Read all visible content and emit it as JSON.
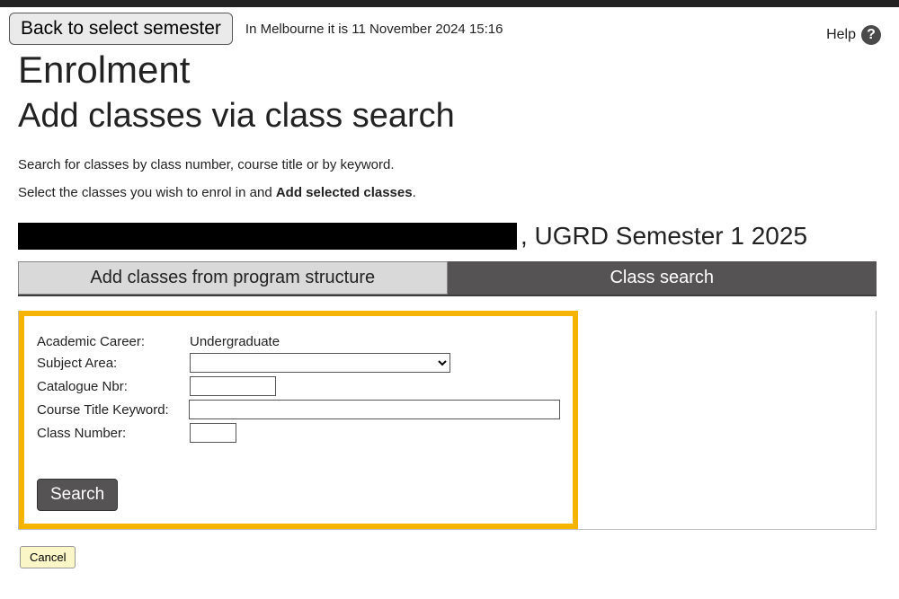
{
  "header": {
    "back_label": "Back to select semester",
    "timestamp": "In Melbourne it is 11 November 2024 15:16",
    "help_label": "Help"
  },
  "titles": {
    "main": "Enrolment",
    "sub": "Add classes via class search"
  },
  "intro": {
    "line1": "Search for classes by class number, course title or by keyword.",
    "line2_pre": "Select the classes you wish to enrol in and ",
    "line2_bold": "Add selected classes",
    "line2_post": "."
  },
  "context": {
    "suffix": ", UGRD Semester 1 2025"
  },
  "tabs": {
    "inactive": "Add classes from program structure",
    "active": "Class search"
  },
  "form": {
    "academic_career_label": "Academic Career:",
    "academic_career_value": "Undergraduate",
    "subject_area_label": "Subject Area:",
    "catalogue_nbr_label": "Catalogue Nbr:",
    "course_title_label": "Course Title Keyword:",
    "class_number_label": "Class Number:",
    "search_label": "Search"
  },
  "footer": {
    "cancel_label": "Cancel"
  }
}
